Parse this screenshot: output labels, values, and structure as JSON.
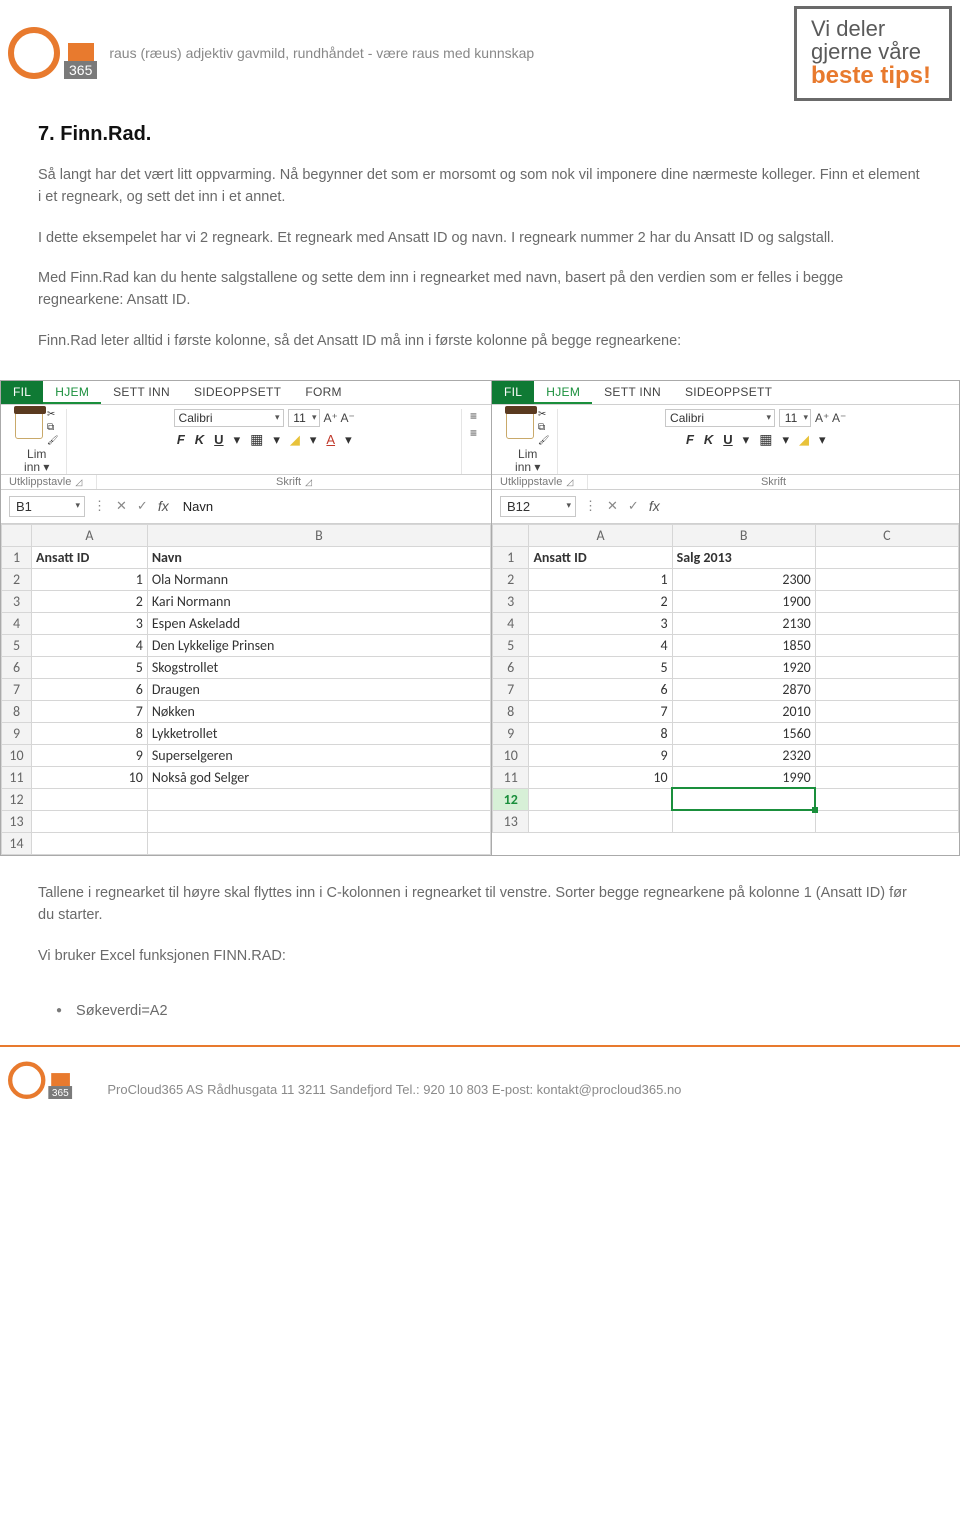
{
  "header": {
    "tagline": "raus (ræus) adjektiv gavmild, rundhåndet - være raus med kunnskap",
    "box365": "365",
    "tips_l1a": "Vi deler",
    "tips_l1b": "gjerne våre",
    "tips_l2": "beste tips!"
  },
  "heading": "7. Finn.Rad.",
  "paras": {
    "p1": "Så langt har det vært litt oppvarming. Nå begynner det som er morsomt og som nok vil imponere dine nærmeste kolleger. Finn et element i et regneark, og sett det inn i et annet.",
    "p2": "I dette eksempelet har vi 2 regneark. Et regneark med Ansatt ID og navn. I regneark nummer 2 har du Ansatt ID og salgstall.",
    "p3": "Med Finn.Rad kan du hente salgstallene og sette dem inn i regnearket med navn, basert på den verdien som er felles i begge regnearkene: Ansatt ID.",
    "p4": "Finn.Rad leter alltid i første kolonne, så det Ansatt ID må inn i første kolonne på begge regnearkene:",
    "p5": "Tallene i regnearket til høyre skal flyttes inn i C-kolonnen i regnearket til venstre. Sorter begge regnearkene på kolonne 1 (Ansatt ID) før du starter.",
    "p6": "Vi bruker Excel funksjonen FINN.RAD:"
  },
  "bullet1": "Søkeverdi=A2",
  "excel_common": {
    "tabs_fil": "FIL",
    "tabs_hjem": "HJEM",
    "tabs_settinn": "SETT INN",
    "tabs_sideopp": "SIDEOPPSETT",
    "tabs_form": "FORM",
    "lim": "Lim",
    "inn": "inn",
    "utklippstavle": "Utklippstavle",
    "skrift": "Skrift",
    "font_name": "Calibri",
    "font_size": "11",
    "aa": "A⁺  A⁻",
    "fmt_f": "F",
    "fmt_k": "K",
    "fmt_u": "U",
    "fx": "fx"
  },
  "left": {
    "namebox": "B1",
    "fbar": "Navn",
    "cols": [
      "A",
      "B"
    ],
    "row1": {
      "a": "Ansatt ID",
      "b": "Navn"
    },
    "rows": [
      {
        "n": 1,
        "b": "Ola Normann"
      },
      {
        "n": 2,
        "b": "Kari Normann"
      },
      {
        "n": 3,
        "b": "Espen Askeladd"
      },
      {
        "n": 4,
        "b": "Den Lykkelige Prinsen"
      },
      {
        "n": 5,
        "b": "Skogstrollet"
      },
      {
        "n": 6,
        "b": "Draugen"
      },
      {
        "n": 7,
        "b": "Nøkken"
      },
      {
        "n": 8,
        "b": "Lykketrollet"
      },
      {
        "n": 9,
        "b": "Superselgeren"
      },
      {
        "n": 10,
        "b": "Nokså god Selger"
      }
    ]
  },
  "right": {
    "namebox": "B12",
    "fbar": "",
    "cols": [
      "A",
      "B",
      "C"
    ],
    "row1": {
      "a": "Ansatt ID",
      "b": "Salg 2013"
    },
    "rows": [
      {
        "n": 1,
        "b": 2300
      },
      {
        "n": 2,
        "b": 1900
      },
      {
        "n": 3,
        "b": 2130
      },
      {
        "n": 4,
        "b": 1850
      },
      {
        "n": 5,
        "b": 1920
      },
      {
        "n": 6,
        "b": 2870
      },
      {
        "n": 7,
        "b": 2010
      },
      {
        "n": 8,
        "b": 1560
      },
      {
        "n": 9,
        "b": 2320
      },
      {
        "n": 10,
        "b": 1990
      }
    ]
  },
  "footer": {
    "text": "ProCloud365 AS   Rådhusgata 11   3211 Sandefjord   Tel.: 920 10 803   E-post: kontakt@procloud365.no"
  }
}
